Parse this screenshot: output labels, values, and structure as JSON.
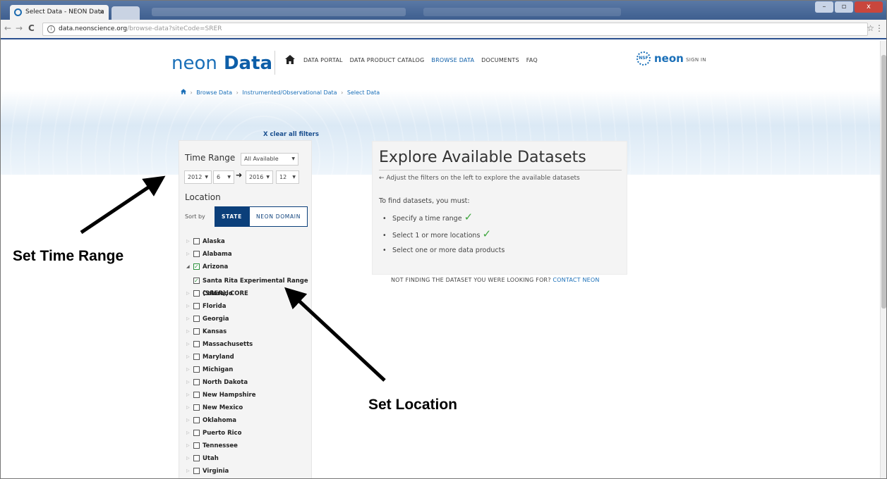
{
  "browser": {
    "tab_title": "Select Data - NEON Data",
    "tab_close": "×",
    "url_host": "data.neonscience.org",
    "url_path": "/browse-data?siteCode=SRER",
    "back": "←",
    "forward": "→",
    "reload": "C",
    "info": "i",
    "star": "☆",
    "menu": "⋮",
    "minimize": "–",
    "maximize": "▫",
    "close": "x"
  },
  "header": {
    "logo_neon": "neon",
    "logo_data": "Data",
    "home_icon": "home-icon",
    "nav": [
      "DATA PORTAL",
      "DATA PRODUCT CATALOG",
      "BROWSE DATA",
      "DOCUMENTS",
      "FAQ"
    ],
    "active_nav": "BROWSE DATA",
    "nsf_badge": "NSF",
    "neon_small": "neon",
    "sign_in": "SIGN IN"
  },
  "breadcrumb": {
    "items": [
      "Browse Data",
      "Instrumented/Observational Data",
      "Select Data"
    ],
    "separator": "›"
  },
  "filters": {
    "clear": "X clear all filters",
    "time_range_label": "Time Range",
    "time_range_select": "All Available",
    "start_year": "2012",
    "start_month": "6",
    "end_year": "2016",
    "end_month": "12",
    "range_arrow": "➜",
    "location_label": "Location",
    "sort_by": "Sort by",
    "sort_state": "STATE",
    "sort_domain": "NEON DOMAIN",
    "states_before": [
      "Alaska",
      "Alabama"
    ],
    "checked_state": "Arizona",
    "site": "Santa Rita Experimental Range (SRER), CORE",
    "states_after": [
      "Colorado",
      "Florida",
      "Georgia",
      "Kansas",
      "Massachusetts",
      "Maryland",
      "Michigan",
      "North Dakota",
      "New Hampshire",
      "New Mexico",
      "Oklahoma",
      "Puerto Rico",
      "Tennessee",
      "Utah",
      "Virginia"
    ]
  },
  "explore": {
    "title": "Explore Available Datasets",
    "hint": "← Adjust the filters on the left to explore the available datasets",
    "must": "To find datasets, you must:",
    "steps": [
      {
        "text": "Specify a time range",
        "done": "✓"
      },
      {
        "text": "Select 1 or more locations",
        "done": "✓"
      },
      {
        "text": "Select one or more data products",
        "done": ""
      }
    ],
    "not_finding": "NOT FINDING THE DATASET YOU WERE LOOKING FOR?",
    "contact": "CONTACT NEON"
  },
  "annotations": {
    "time_range": "Set Time Range",
    "location": "Set Location"
  }
}
